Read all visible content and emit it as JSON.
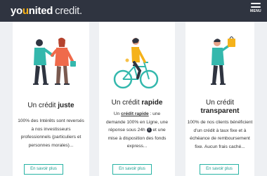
{
  "header": {
    "logo_part1a": "yo",
    "logo_part1b": "u",
    "logo_part1c": "nited",
    "logo_part2": "credit.",
    "menu_label": "MENU"
  },
  "cards": [
    {
      "title_pre": "Un crédit",
      "title_bold": "juste",
      "desc_lines": [
        "100% des Intérêts sont reversés",
        "à nos investisseurs",
        "professionnels (particuliers et",
        "personnes morales)..."
      ],
      "button": "En savoir plus"
    },
    {
      "title_pre": "Un crédit",
      "title_bold": "rapide",
      "desc_line1_pre": "Un",
      "desc_line1_link": "crédit rapide",
      "desc_line1_post": ": une",
      "desc_lines": [
        "demande 100% en Ligne, une"
      ],
      "desc_line3_pre": "réponse sous 24h",
      "info_icon": "i",
      "desc_line3_post": "et une",
      "desc_lines_after": [
        "mise à disposition des fonds",
        "express..."
      ],
      "button": "En savoir plus"
    },
    {
      "title_line1": "Un crédit",
      "title_bold": "transparent",
      "desc_lines": [
        "100% de nos clients bénéficient",
        "d'un crédit à taux fixe et à",
        "échéance de remboursement",
        "fixe. Aucun frais caché..."
      ],
      "button": "En savoir plus"
    }
  ],
  "colors": {
    "header_bg": "#2f3440",
    "accent": "#f5b21a",
    "button_border": "#27b3a4",
    "teal": "#34b8ad"
  }
}
